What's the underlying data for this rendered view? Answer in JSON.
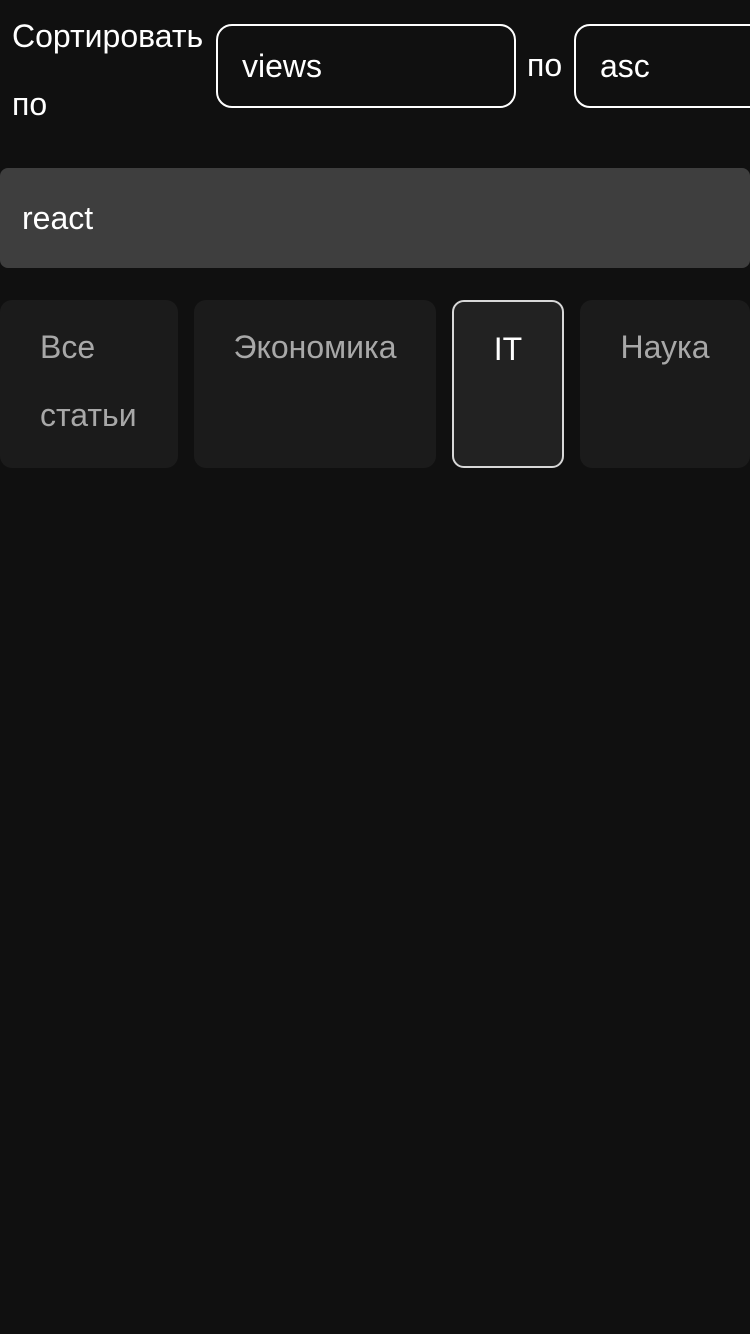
{
  "sort": {
    "label": "Сортировать по",
    "field_value": "views",
    "by_label": "по",
    "order_value": "asc"
  },
  "search": {
    "value": "react"
  },
  "tabs": [
    {
      "label": "Все статьи",
      "selected": false
    },
    {
      "label": "Экономика",
      "selected": false
    },
    {
      "label": "IT",
      "selected": true
    },
    {
      "label": "Наука",
      "selected": false
    }
  ],
  "colors": {
    "background": "#101010",
    "search_background": "#3e3e3e",
    "tab_background": "#1b1b1b",
    "tab_selected_border": "#d8d8d8",
    "text_primary": "#ffffff",
    "text_muted": "#a8a8a8"
  }
}
